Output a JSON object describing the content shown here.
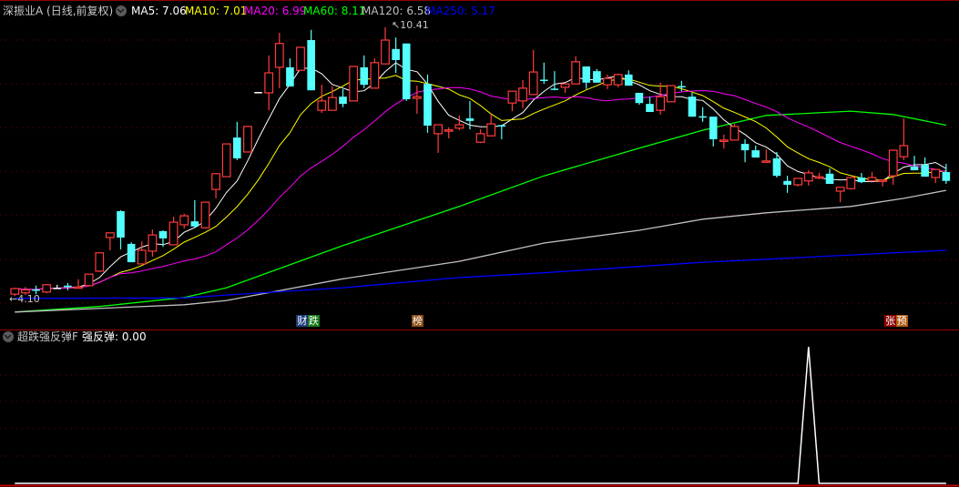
{
  "header": {
    "title": "深振业A (日线,前复权)",
    "ma": [
      {
        "label": "MA5: 7.06",
        "color": "#ffffff"
      },
      {
        "label": "MA10: 7.01",
        "color": "#ffff00"
      },
      {
        "label": "MA20: 6.99",
        "color": "#ff00ff"
      },
      {
        "label": "MA60: 8.11",
        "color": "#00ff00"
      },
      {
        "label": "MA120: 6.58",
        "color": "#c0c0c0"
      },
      {
        "label": "MA250: 5.17",
        "color": "#0000ff"
      }
    ]
  },
  "annotations": {
    "high_label": "10.41",
    "low_label": "4.10"
  },
  "event_tags": [
    {
      "chars": [
        "财",
        "跌"
      ],
      "colors": [
        "#1c3a78",
        "#187818"
      ],
      "index": 26
    },
    {
      "chars": [
        "榜"
      ],
      "colors": [
        "#8a4a10"
      ],
      "index": 38
    },
    {
      "chars": [
        "张",
        "预"
      ],
      "colors": [
        "#8b0000",
        "#b05a10"
      ],
      "index": 82
    }
  ],
  "indicator": {
    "name": "超跌强反弹F",
    "value_label": "强反弹: 0.00",
    "color": "#ffffff",
    "signals": [
      {
        "index": 75,
        "value": 1
      }
    ]
  },
  "chart_data": {
    "type": "candlestick",
    "candle_fields": [
      "open",
      "high",
      "low",
      "close"
    ],
    "up_color": "#ff3c3c",
    "down_color": "#54ffff",
    "ylim": [
      4.1,
      10.41
    ],
    "candles": [
      [
        4.14,
        4.29,
        4.1,
        4.27
      ],
      [
        4.17,
        4.31,
        4.12,
        4.24
      ],
      [
        4.25,
        4.34,
        4.14,
        4.24
      ],
      [
        4.19,
        4.38,
        4.16,
        4.36
      ],
      [
        4.29,
        4.36,
        4.27,
        4.29
      ],
      [
        4.34,
        4.4,
        4.23,
        4.33
      ],
      [
        4.3,
        4.49,
        4.29,
        4.31
      ],
      [
        4.34,
        4.62,
        4.33,
        4.61
      ],
      [
        4.68,
        5.12,
        4.66,
        5.11
      ],
      [
        5.47,
        5.58,
        5.17,
        5.58
      ],
      [
        6.09,
        6.11,
        5.19,
        5.47
      ],
      [
        5.32,
        5.36,
        4.89,
        4.89
      ],
      [
        4.85,
        5.38,
        4.85,
        5.17
      ],
      [
        5.15,
        5.66,
        5.02,
        5.53
      ],
      [
        5.62,
        5.64,
        5.25,
        5.45
      ],
      [
        5.3,
        5.96,
        5.3,
        5.83
      ],
      [
        5.77,
        6.03,
        5.68,
        5.98
      ],
      [
        5.85,
        6.35,
        5.7,
        5.73
      ],
      [
        5.7,
        6.3,
        5.68,
        6.3
      ],
      [
        6.6,
        6.97,
        6.39,
        6.97
      ],
      [
        6.9,
        7.67,
        6.9,
        7.67
      ],
      [
        7.82,
        8.19,
        7.29,
        7.33
      ],
      [
        7.48,
        8.08,
        7.48,
        8.08
      ],
      [
        8.89,
        8.89,
        8.89,
        8.89
      ],
      [
        8.87,
        9.75,
        8.46,
        9.34
      ],
      [
        9.47,
        10.28,
        8.98,
        10.03
      ],
      [
        9.47,
        9.68,
        9.02,
        9.02
      ],
      [
        9.4,
        9.94,
        9.4,
        9.94
      ],
      [
        10.11,
        10.35,
        8.93,
        8.93
      ],
      [
        8.46,
        9.06,
        8.4,
        8.68
      ],
      [
        8.46,
        9.02,
        8.46,
        8.76
      ],
      [
        8.78,
        8.96,
        8.53,
        8.61
      ],
      [
        8.68,
        9.49,
        8.68,
        9.49
      ],
      [
        9.47,
        9.75,
        8.98,
        9.06
      ],
      [
        8.98,
        9.68,
        8.98,
        9.58
      ],
      [
        9.55,
        10.41,
        9.55,
        10.11
      ],
      [
        9.9,
        10.17,
        9.34,
        9.64
      ],
      [
        10.03,
        10.03,
        8.68,
        8.72
      ],
      [
        8.74,
        9.04,
        8.38,
        8.78
      ],
      [
        9.08,
        9.3,
        7.93,
        8.1
      ],
      [
        7.91,
        8.12,
        7.46,
        8.12
      ],
      [
        7.99,
        8.06,
        7.8,
        8.0
      ],
      [
        8.04,
        8.34,
        7.99,
        8.12
      ],
      [
        8.27,
        8.68,
        8.01,
        8.21
      ],
      [
        7.71,
        8.01,
        7.69,
        7.91
      ],
      [
        7.86,
        8.36,
        7.86,
        8.14
      ],
      [
        8.11,
        8.12,
        7.78,
        8.1
      ],
      [
        8.63,
        8.91,
        8.44,
        8.91
      ],
      [
        8.68,
        9.17,
        8.51,
        8.98
      ],
      [
        8.83,
        9.88,
        8.83,
        9.36
      ],
      [
        9.18,
        9.58,
        9.08,
        9.17
      ],
      [
        8.97,
        9.38,
        8.93,
        8.96
      ],
      [
        9.0,
        9.08,
        8.87,
        9.08
      ],
      [
        9.08,
        9.73,
        9.08,
        9.6
      ],
      [
        9.49,
        9.49,
        8.96,
        9.11
      ],
      [
        9.38,
        9.43,
        9.11,
        9.11
      ],
      [
        9.06,
        9.3,
        8.96,
        9.21
      ],
      [
        9.06,
        9.32,
        9.0,
        9.3
      ],
      [
        9.3,
        9.4,
        9.04,
        9.04
      ],
      [
        8.87,
        8.87,
        8.59,
        8.63
      ],
      [
        8.61,
        8.78,
        8.42,
        8.42
      ],
      [
        8.46,
        9.11,
        8.36,
        8.78
      ],
      [
        8.66,
        9.04,
        8.66,
        9.04
      ],
      [
        9.03,
        9.15,
        8.91,
        9.02
      ],
      [
        8.78,
        8.87,
        8.31,
        8.31
      ],
      [
        8.32,
        8.53,
        8.19,
        8.31
      ],
      [
        8.31,
        8.31,
        7.61,
        7.78
      ],
      [
        7.75,
        7.89,
        7.56,
        7.76
      ],
      [
        7.76,
        8.14,
        7.76,
        8.08
      ],
      [
        7.67,
        7.78,
        7.24,
        7.52
      ],
      [
        7.52,
        7.63,
        7.35,
        7.35
      ],
      [
        7.26,
        7.54,
        7.22,
        7.27
      ],
      [
        7.33,
        7.48,
        6.88,
        6.92
      ],
      [
        6.8,
        6.92,
        6.52,
        6.71
      ],
      [
        6.71,
        6.86,
        6.67,
        6.86
      ],
      [
        6.8,
        7.05,
        6.69,
        6.99
      ],
      [
        6.89,
        6.99,
        6.84,
        6.9
      ],
      [
        6.97,
        7.09,
        6.73,
        6.73
      ],
      [
        6.56,
        6.65,
        6.3,
        6.65
      ],
      [
        6.62,
        6.88,
        6.6,
        6.88
      ],
      [
        6.88,
        6.99,
        6.75,
        6.77
      ],
      [
        6.8,
        7.01,
        6.8,
        6.88
      ],
      [
        6.81,
        6.83,
        6.67,
        6.82
      ],
      [
        6.92,
        7.52,
        6.71,
        7.52
      ],
      [
        7.37,
        8.27,
        7.29,
        7.63
      ],
      [
        7.14,
        7.39,
        7.05,
        7.05
      ],
      [
        7.18,
        7.35,
        6.9,
        6.9
      ],
      [
        6.88,
        7.07,
        6.75,
        7.07
      ],
      [
        7.01,
        7.2,
        6.73,
        6.8
      ]
    ],
    "computed_ma": [
      {
        "period": 5,
        "color": "#ffffff"
      },
      {
        "period": 10,
        "color": "#ffff00"
      },
      {
        "period": 20,
        "color": "#ff00ff"
      }
    ],
    "ma_lines": [
      {
        "period": 60,
        "color": "#00ff00",
        "points": [
          [
            0,
            3.72
          ],
          [
            8,
            3.85
          ],
          [
            16,
            4.06
          ],
          [
            20,
            4.29
          ],
          [
            31,
            5.28
          ],
          [
            42,
            6.2
          ],
          [
            50,
            6.92
          ],
          [
            59,
            7.57
          ],
          [
            65,
            7.99
          ],
          [
            71,
            8.34
          ],
          [
            79,
            8.44
          ],
          [
            83,
            8.36
          ],
          [
            88,
            8.11
          ]
        ]
      },
      {
        "period": 120,
        "color": "#c0c0c0",
        "points": [
          [
            0,
            3.72
          ],
          [
            16,
            3.89
          ],
          [
            20,
            3.99
          ],
          [
            31,
            4.5
          ],
          [
            42,
            4.91
          ],
          [
            50,
            5.34
          ],
          [
            59,
            5.64
          ],
          [
            65,
            5.9
          ],
          [
            71,
            6.05
          ],
          [
            79,
            6.2
          ],
          [
            84,
            6.39
          ],
          [
            88,
            6.58
          ]
        ]
      },
      {
        "period": 250,
        "color": "#0000ff",
        "points": [
          [
            0,
            4.04
          ],
          [
            16,
            4.05
          ],
          [
            20,
            4.12
          ],
          [
            31,
            4.29
          ],
          [
            42,
            4.53
          ],
          [
            50,
            4.64
          ],
          [
            65,
            4.89
          ],
          [
            71,
            4.96
          ],
          [
            79,
            5.06
          ],
          [
            88,
            5.17
          ]
        ]
      }
    ]
  }
}
